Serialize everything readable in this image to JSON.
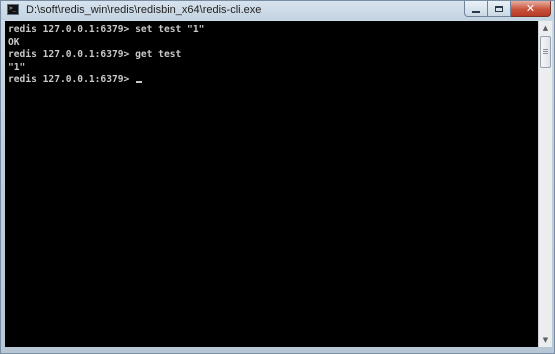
{
  "window": {
    "title": "D:\\soft\\redis_win\\redis\\redisbin_x64\\redis-cli.exe",
    "icon": "console-icon",
    "controls": {
      "minimize_icon": "minimize-icon",
      "maximize_icon": "maximize-icon",
      "close_icon": "close-icon",
      "close_glyph": "✕",
      "icon_prompt": ">_"
    }
  },
  "console": {
    "background": "#000000",
    "text_color": "#c8c8c8",
    "lines": [
      "redis 127.0.0.1:6379> set test \"1\"",
      "OK",
      "redis 127.0.0.1:6379> get test",
      "\"1\"",
      "redis 127.0.0.1:6379> "
    ]
  },
  "scrollbar": {
    "up_arrow": "▲",
    "down_arrow": "▼",
    "position_fraction": 0
  }
}
